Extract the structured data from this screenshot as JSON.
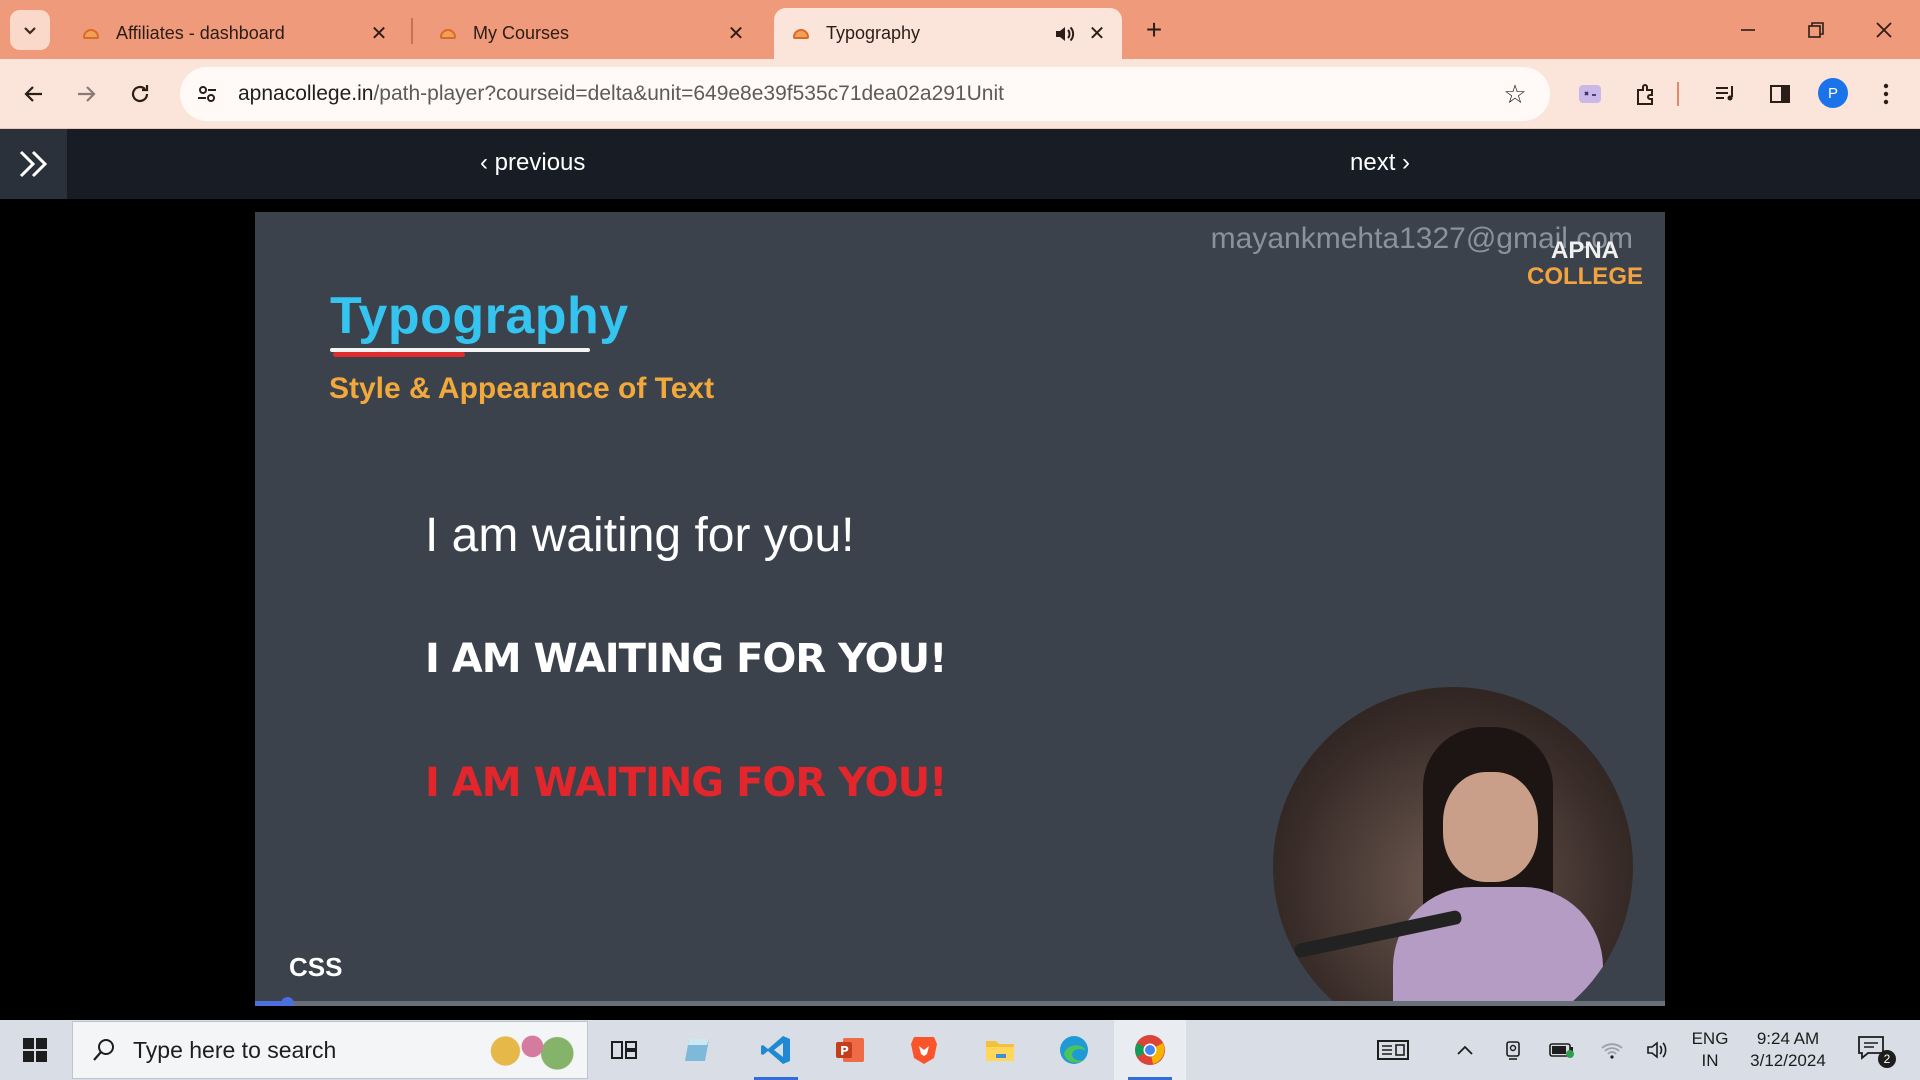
{
  "browser": {
    "tabs": [
      {
        "title": "Affiliates - dashboard",
        "active": false
      },
      {
        "title": "My Courses",
        "active": false
      },
      {
        "title": "Typography",
        "active": true,
        "audio": true
      }
    ],
    "url": {
      "host": "apnacollege.in",
      "path": "/path-player?courseid=delta&unit=649e8e39f535c71dea02a291Unit"
    },
    "profile_initial": "P",
    "accent": "#ef9a7a"
  },
  "player": {
    "previous_label": "previous",
    "next_label": "next"
  },
  "video": {
    "watermark": "mayankmehta1327@gmail.com",
    "brand_line1": "APNA",
    "brand_line2": "COLLEGE",
    "slide_title": "Typography",
    "slide_subtitle": "Style & Appearance of Text",
    "example_line1": "I am waiting for you!",
    "example_line2": "I AM WAITING FOR YOU!",
    "example_line3": "I AM WAITING FOR YOU!",
    "footer_tag": "CSS",
    "progress": 0.023
  },
  "taskbar": {
    "search_placeholder": "Type here to search",
    "apps": [
      "task-view-icon",
      "notepad-icon",
      "vscode-icon",
      "powerpoint-icon",
      "brave-icon",
      "file-explorer-icon",
      "edge-icon",
      "chrome-icon"
    ],
    "lang_line1": "ENG",
    "lang_line2": "IN",
    "time": "9:24 AM",
    "date": "3/12/2024",
    "notification_count": "2"
  }
}
